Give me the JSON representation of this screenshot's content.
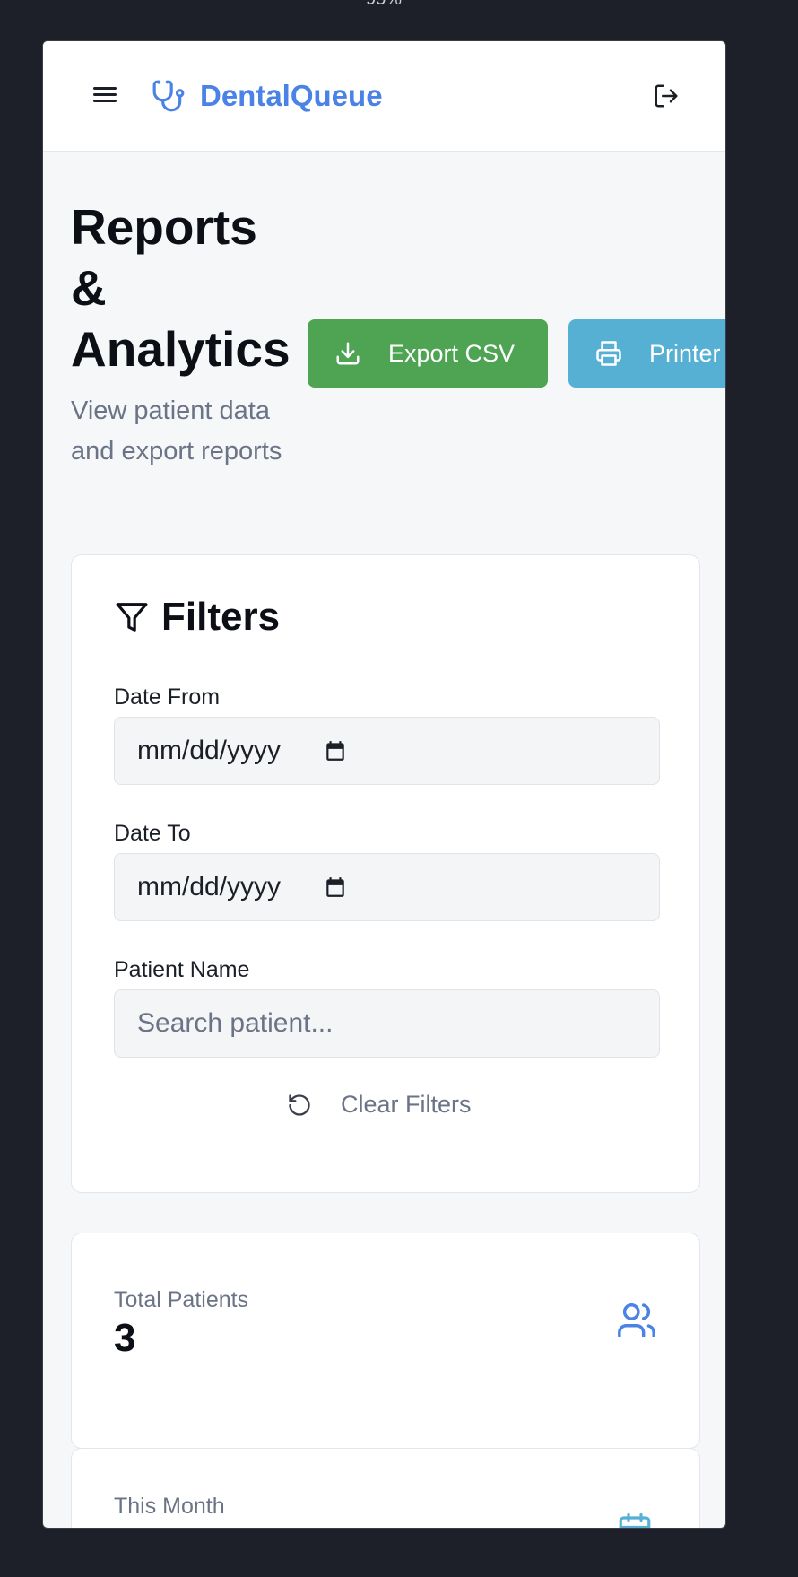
{
  "zoom": "95%",
  "app": {
    "brand": "DentalQueue"
  },
  "page": {
    "title": "Reports & Analytics",
    "subtitle": "View patient data and export reports"
  },
  "actions": {
    "export_label": "Export CSV",
    "print_label": "Printer"
  },
  "filters": {
    "title": "Filters",
    "date_from_label": "Date From",
    "date_from_value": "mm/dd/yyyy",
    "date_to_label": "Date To",
    "date_to_value": "mm/dd/yyyy",
    "patient_name_label": "Patient Name",
    "patient_placeholder": "Search patient...",
    "clear_label": "Clear Filters"
  },
  "stats": [
    {
      "label": "Total Patients",
      "value": "3",
      "icon": "users-icon"
    },
    {
      "label": "This Month",
      "value": "",
      "icon": "calendar-icon"
    }
  ],
  "colors": {
    "brand": "#4b82e6",
    "export_button": "#4ea453",
    "print_button": "#56b0d3",
    "stat_icon": "#4b82e6",
    "stat_icon_month": "#56b0d3"
  }
}
